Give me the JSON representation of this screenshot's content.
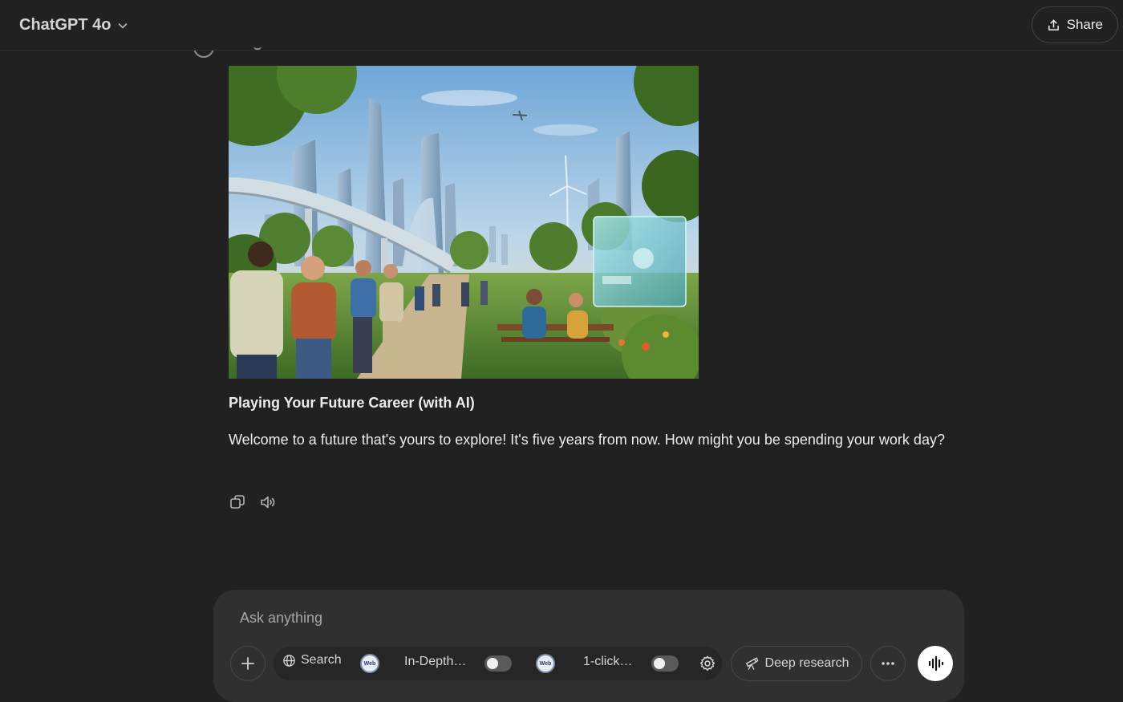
{
  "header": {
    "model_name": "ChatGPT 4o",
    "share_label": "Share"
  },
  "message": {
    "title": "Playing Your Future Career (with AI)",
    "body": "Welcome to a future that's yours to explore! It's five years from now. How might you be spending your work day?"
  },
  "composer": {
    "placeholder": "Ask anything",
    "tools": {
      "search_label": "Search",
      "tool1_label": "In-Depth…",
      "tool2_label": "1-click…",
      "webpilot_badge": "Web",
      "deep_research_label": "Deep research"
    }
  },
  "icons": {
    "chevron": "chevron-down-icon",
    "share": "share-icon",
    "copy": "copy-icon",
    "speaker": "speaker-icon",
    "plus": "plus-icon",
    "globe": "globe-icon",
    "gear": "gear-icon",
    "telescope": "telescope-icon",
    "more": "more-dots-icon",
    "voice": "voice-waveform-icon"
  },
  "colors": {
    "background": "#212121",
    "composer": "#303030",
    "text": "#ececec",
    "muted": "#a6a6a6"
  }
}
